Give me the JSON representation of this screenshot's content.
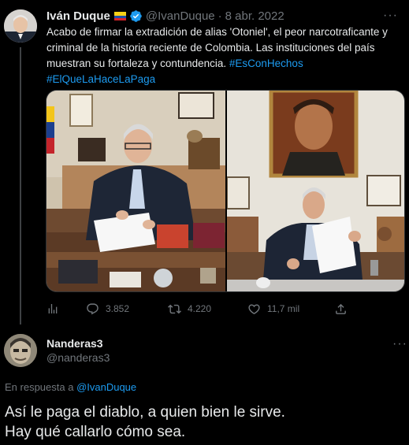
{
  "tweet": {
    "author": {
      "name": "Iván Duque",
      "handle": "@IvanDuque",
      "verified": true,
      "flag": "colombia-flag"
    },
    "separator": "·",
    "date": "8 abr. 2022",
    "text": "Acabo de firmar la extradición de alias 'Otoniel', el peor narcotraficante y criminal de la historia reciente de Colombia. Las instituciones del país muestran su fortaleza y contundencia. ",
    "hashtags": [
      "#EsConHechos",
      "#ElQueLaHaceLaPaga"
    ],
    "media": [
      {
        "icon": "photo-duque-signing-desk"
      },
      {
        "icon": "photo-duque-holding-document-portrait"
      }
    ],
    "actions": {
      "analytics": {
        "icon": "analytics-icon",
        "count": ""
      },
      "reply": {
        "icon": "reply-icon",
        "count": "3.852"
      },
      "retweet": {
        "icon": "retweet-icon",
        "count": "4.220"
      },
      "like": {
        "icon": "like-icon",
        "count": "11,7 mil"
      },
      "share": {
        "icon": "share-icon",
        "count": ""
      }
    }
  },
  "reply_tweet": {
    "author": {
      "name": "Nanderas3",
      "handle": "@nanderas3"
    },
    "replying_prefix": "En respuesta a ",
    "replying_to": "@IvanDuque",
    "lines": [
      "Así le paga el diablo, a quien bien le sirve.",
      "Hay qué callarlo cómo sea."
    ]
  },
  "colors": {
    "background": "#000000",
    "text": "#e7e9ea",
    "muted": "#71767b",
    "link": "#1d9bf0",
    "verified": "#1d9bf0"
  }
}
